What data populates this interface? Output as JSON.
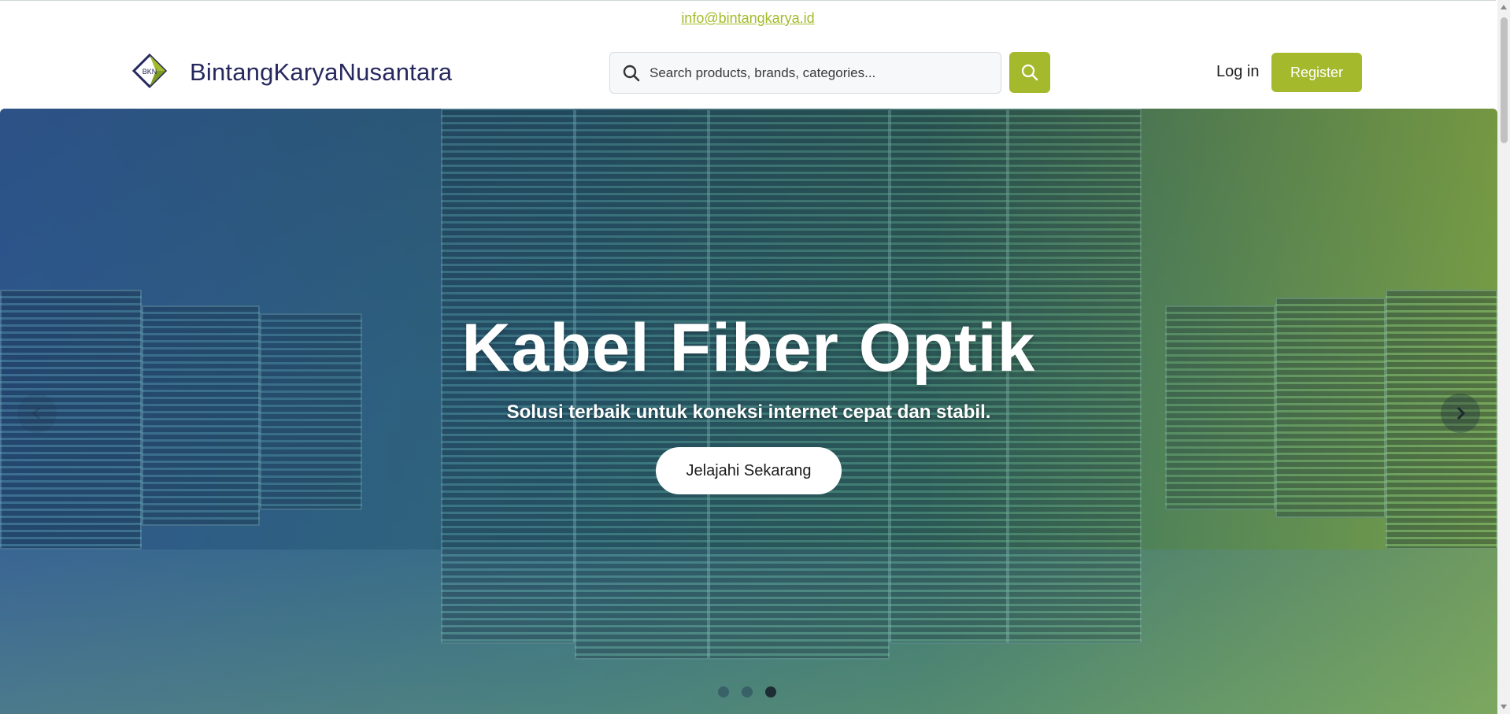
{
  "topbar": {
    "email": "info@bintangkarya.id"
  },
  "header": {
    "logo_text": "BKN",
    "brand": "BintangKaryaNusantara",
    "search_placeholder": "Search products, brands, categories...",
    "login_label": "Log in",
    "register_label": "Register"
  },
  "hero": {
    "title": "Kabel Fiber Optik",
    "subtitle": "Solusi terbaik untuk koneksi internet cepat dan stabil.",
    "cta_label": "Jelajahi Sekarang",
    "slide_count": 3,
    "active_slide": 3
  },
  "colors": {
    "accent": "#a4ba2c",
    "brand_text": "#26285e",
    "email_link": "#a3bb2b"
  },
  "icons": [
    "bkn-logo-icon",
    "search-icon",
    "search-button-icon",
    "chevron-left-icon",
    "chevron-right-icon"
  ]
}
